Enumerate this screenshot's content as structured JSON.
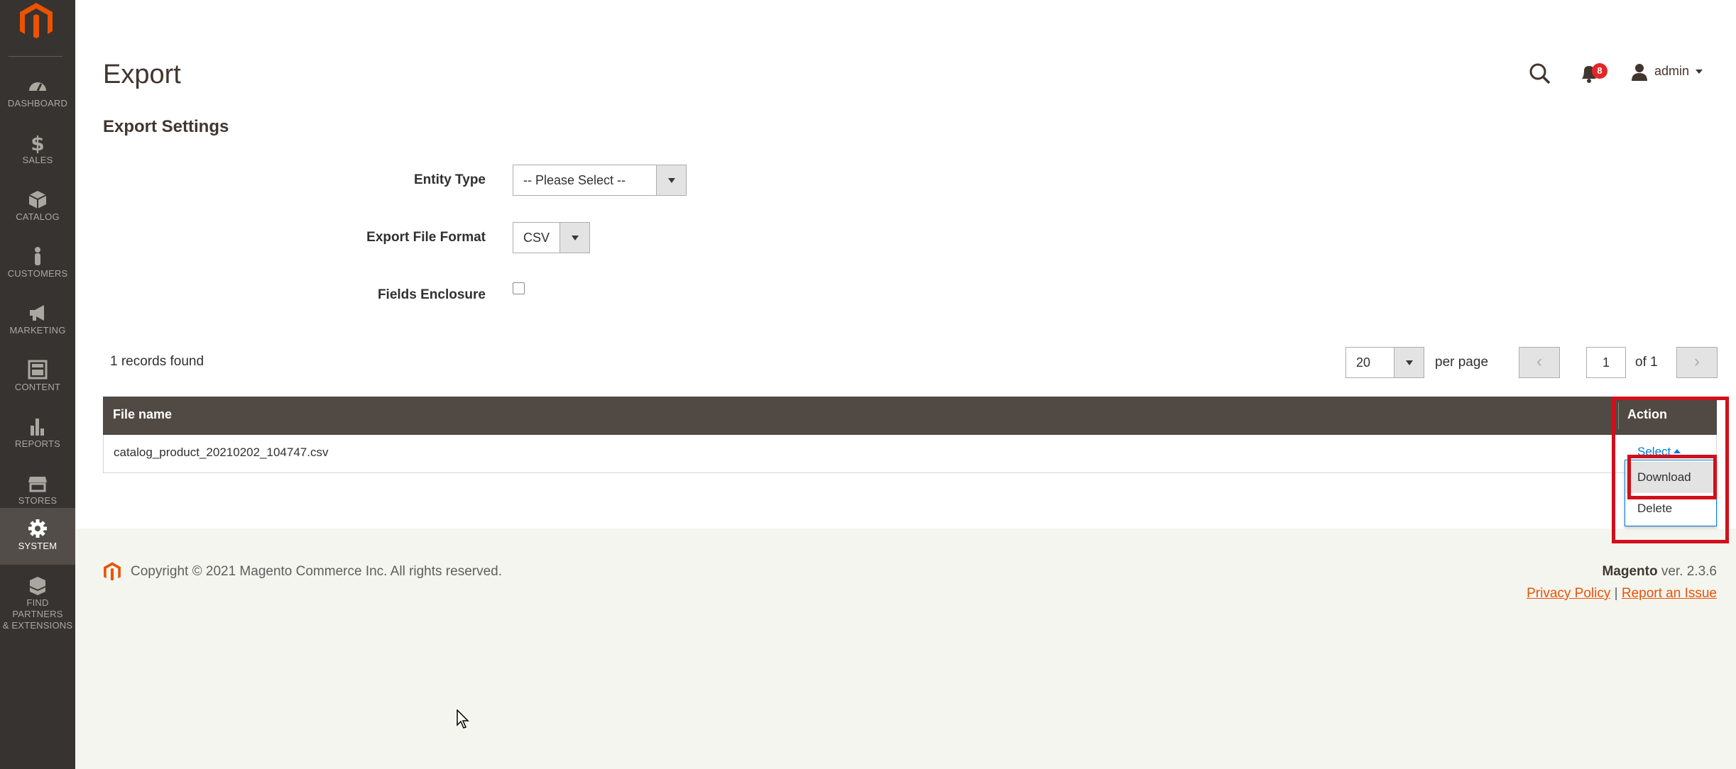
{
  "colors": {
    "brand": "#eb5202",
    "sidebar_bg": "#373330",
    "grid_header_bg": "#514943",
    "link": "#007bdb",
    "highlight": "#d0101b"
  },
  "sidebar": {
    "items": [
      {
        "label": "DASHBOARD",
        "icon": "speedometer-icon"
      },
      {
        "label": "SALES",
        "icon": "dollar-icon"
      },
      {
        "label": "CATALOG",
        "icon": "box-icon"
      },
      {
        "label": "CUSTOMERS",
        "icon": "person-icon"
      },
      {
        "label": "MARKETING",
        "icon": "megaphone-icon"
      },
      {
        "label": "CONTENT",
        "icon": "layout-icon"
      },
      {
        "label": "REPORTS",
        "icon": "bar-chart-icon"
      },
      {
        "label": "STORES",
        "icon": "storefront-icon"
      },
      {
        "label": "SYSTEM",
        "icon": "gear-icon"
      },
      {
        "label_line1": "FIND PARTNERS",
        "label_line2": "& EXTENSIONS",
        "icon": "cubes-icon"
      }
    ]
  },
  "header": {
    "title": "Export",
    "notifications_count": "8",
    "user_name": "admin"
  },
  "settings": {
    "section_title": "Export Settings",
    "entity_type_label": "Entity Type",
    "entity_type_value": "-- Please Select --",
    "file_format_label": "Export File Format",
    "file_format_value": "CSV",
    "fields_enclosure_label": "Fields Enclosure",
    "fields_enclosure_checked": false
  },
  "pager": {
    "records_found": "1 records found",
    "per_page_value": "20",
    "per_page_label": "per page",
    "current_page": "1",
    "of_pages": "of 1",
    "prev": "‹",
    "next": "›"
  },
  "grid": {
    "columns": [
      "File name",
      "Action"
    ],
    "rows": [
      {
        "file_name": "catalog_product_20210202_104747.csv",
        "action": "Select"
      }
    ],
    "action_menu": [
      "Download",
      "Delete"
    ]
  },
  "footer": {
    "copyright": "Copyright © 2021 Magento Commerce Inc. All rights reserved.",
    "brand": "Magento",
    "version": " ver. 2.3.6",
    "privacy": "Privacy Policy",
    "separator": "|",
    "report": "Report an Issue"
  }
}
